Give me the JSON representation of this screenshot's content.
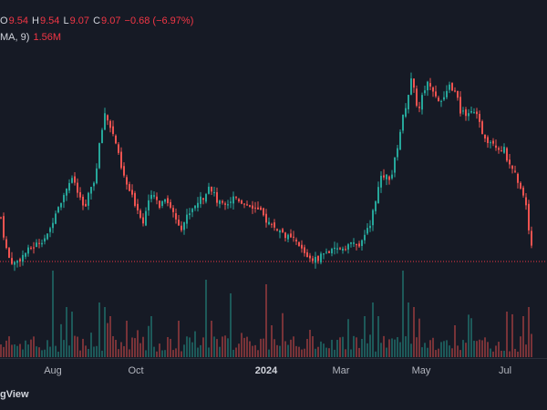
{
  "legend": {
    "open_label": "O",
    "open": "9.54",
    "high_label": "H",
    "high": "9.54",
    "low_label": "L",
    "low": "9.07",
    "close_label": "C",
    "close": "9.07",
    "change": "−0.68 (−6.97%)",
    "volume_label": "MA, 9)",
    "volume_value": "1.56M"
  },
  "brand": "gView",
  "colors": {
    "up": "#26a69a",
    "down": "#ef5350",
    "background": "#161a25",
    "price_line": "#f23645"
  },
  "chart_data": {
    "type": "candlestick",
    "x_ticks": [
      "Aug",
      "Oct",
      "2024",
      "Mar",
      "May",
      "Jul"
    ],
    "bold_ticks": [
      "2024"
    ],
    "ylim": [
      8.2,
      26.3
    ],
    "last_price": 9.07,
    "trend": [
      [
        0,
        12.3
      ],
      [
        4,
        10.6
      ],
      [
        8,
        9.4
      ],
      [
        14,
        8.9
      ],
      [
        20,
        9.2
      ],
      [
        28,
        9.8
      ],
      [
        36,
        10.2
      ],
      [
        44,
        10.6
      ],
      [
        52,
        11.0
      ],
      [
        60,
        12.8
      ],
      [
        68,
        13.8
      ],
      [
        74,
        14.9
      ],
      [
        80,
        15.1
      ],
      [
        86,
        13.7
      ],
      [
        92,
        12.9
      ],
      [
        98,
        14.4
      ],
      [
        104,
        15.3
      ],
      [
        108,
        17.6
      ],
      [
        114,
        20.0
      ],
      [
        120,
        19.0
      ],
      [
        126,
        17.8
      ],
      [
        132,
        15.9
      ],
      [
        138,
        14.7
      ],
      [
        144,
        13.8
      ],
      [
        150,
        12.9
      ],
      [
        156,
        12.0
      ],
      [
        162,
        13.6
      ],
      [
        168,
        13.9
      ],
      [
        174,
        13.2
      ],
      [
        180,
        13.8
      ],
      [
        186,
        13.1
      ],
      [
        192,
        12.2
      ],
      [
        198,
        11.6
      ],
      [
        204,
        12.4
      ],
      [
        210,
        13.0
      ],
      [
        216,
        13.5
      ],
      [
        222,
        13.8
      ],
      [
        228,
        14.7
      ],
      [
        232,
        14.3
      ],
      [
        238,
        13.3
      ],
      [
        244,
        13.5
      ],
      [
        250,
        13.4
      ],
      [
        256,
        13.9
      ],
      [
        262,
        13.6
      ],
      [
        268,
        13.3
      ],
      [
        274,
        13.2
      ],
      [
        280,
        12.9
      ],
      [
        286,
        12.6
      ],
      [
        292,
        12.0
      ],
      [
        298,
        11.7
      ],
      [
        304,
        11.4
      ],
      [
        310,
        11.1
      ],
      [
        316,
        10.8
      ],
      [
        322,
        10.6
      ],
      [
        328,
        10.1
      ],
      [
        334,
        9.6
      ],
      [
        340,
        9.3
      ],
      [
        346,
        9.2
      ],
      [
        352,
        9.6
      ],
      [
        358,
        9.8
      ],
      [
        364,
        9.8
      ],
      [
        370,
        10.0
      ],
      [
        376,
        10.1
      ],
      [
        382,
        10.3
      ],
      [
        388,
        10.4
      ],
      [
        394,
        10.2
      ],
      [
        400,
        11.0
      ],
      [
        406,
        12.1
      ],
      [
        412,
        14.0
      ],
      [
        418,
        15.4
      ],
      [
        424,
        15.3
      ],
      [
        428,
        15.2
      ],
      [
        434,
        17.2
      ],
      [
        440,
        19.4
      ],
      [
        446,
        21.1
      ],
      [
        450,
        22.4
      ],
      [
        454,
        21.4
      ],
      [
        458,
        20.0
      ],
      [
        462,
        21.2
      ],
      [
        466,
        22.0
      ],
      [
        470,
        22.3
      ],
      [
        476,
        21.5
      ],
      [
        482,
        20.8
      ],
      [
        488,
        21.2
      ],
      [
        492,
        22.0
      ],
      [
        496,
        21.8
      ],
      [
        500,
        21.2
      ],
      [
        504,
        20.1
      ],
      [
        510,
        20.0
      ],
      [
        516,
        20.2
      ],
      [
        522,
        19.7
      ],
      [
        528,
        18.6
      ],
      [
        534,
        18.0
      ],
      [
        540,
        17.9
      ],
      [
        546,
        17.4
      ],
      [
        552,
        17.3
      ],
      [
        558,
        16.0
      ],
      [
        564,
        15.5
      ],
      [
        570,
        14.6
      ],
      [
        576,
        13.3
      ],
      [
        580,
        11.0
      ],
      [
        584,
        9.07
      ]
    ],
    "volume_spikes": [
      [
        58,
        0.95
      ],
      [
        72,
        0.55
      ],
      [
        78,
        0.5
      ],
      [
        108,
        0.6
      ],
      [
        114,
        0.55
      ],
      [
        120,
        0.45
      ],
      [
        138,
        0.4
      ],
      [
        164,
        0.45
      ],
      [
        196,
        0.4
      ],
      [
        224,
        0.85
      ],
      [
        232,
        0.4
      ],
      [
        252,
        0.7
      ],
      [
        290,
        0.8
      ],
      [
        296,
        0.35
      ],
      [
        340,
        0.3
      ],
      [
        400,
        0.45
      ],
      [
        408,
        0.6
      ],
      [
        414,
        0.45
      ],
      [
        440,
        0.95
      ],
      [
        446,
        0.6
      ],
      [
        452,
        0.55
      ],
      [
        498,
        0.35
      ],
      [
        554,
        0.5
      ],
      [
        572,
        0.45
      ],
      [
        580,
        0.55
      ],
      [
        584,
        0.5
      ]
    ]
  }
}
